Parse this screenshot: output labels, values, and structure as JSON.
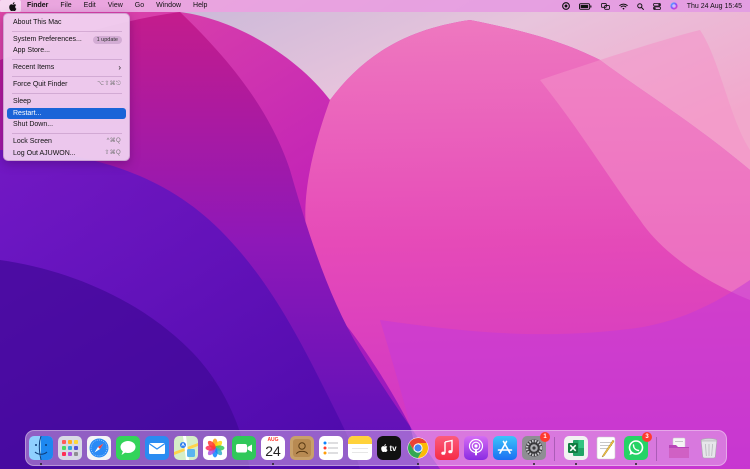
{
  "menubar": {
    "app_name": "Finder",
    "items": [
      "File",
      "Edit",
      "View",
      "Go",
      "Window",
      "Help"
    ],
    "clock": "Thu 24 Aug  15:45"
  },
  "apple_menu": {
    "about": "About This Mac",
    "system_preferences": "System Preferences...",
    "system_preferences_badge": "1 update",
    "app_store": "App Store...",
    "recent_items": "Recent Items",
    "force_quit": "Force Quit Finder",
    "force_quit_shortcut": "⌥⇧⌘⎋",
    "sleep": "Sleep",
    "restart": "Restart...",
    "shut_down": "Shut Down...",
    "lock_screen": "Lock Screen",
    "lock_screen_shortcut": "^⌘Q",
    "log_out": "Log Out AJUWON...",
    "log_out_shortcut": "⇧⌘Q"
  },
  "dock": {
    "calendar_month": "AUG",
    "calendar_day": "24",
    "system_preferences_badge": "1",
    "whatsapp_badge": "3",
    "tv_label": "tv"
  },
  "colors": {
    "menu_highlight": "#1a64d8",
    "badge_red": "#ff3b30"
  }
}
